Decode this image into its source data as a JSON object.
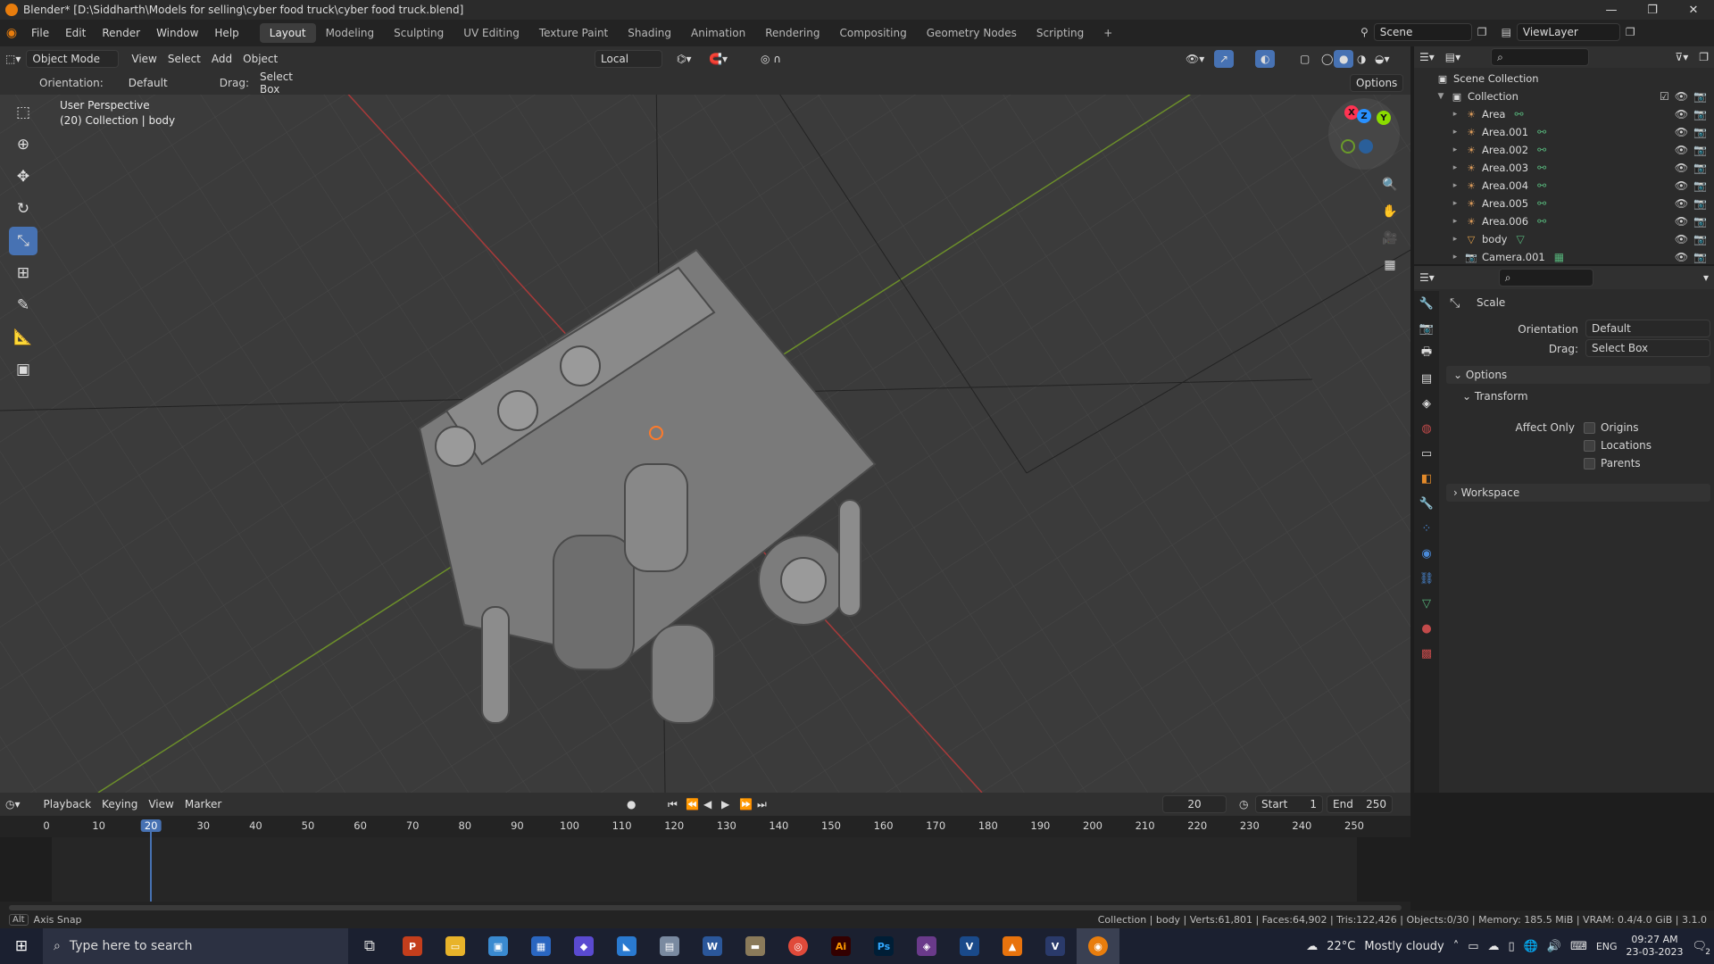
{
  "titlebar": {
    "title": "Blender* [D:\\Siddharth\\Models for selling\\cyber food truck\\cyber food truck.blend]",
    "controls": [
      "—",
      "❐",
      "✕"
    ]
  },
  "menu": [
    "File",
    "Edit",
    "Render",
    "Window",
    "Help"
  ],
  "workspaces": [
    "Layout",
    "Modeling",
    "Sculpting",
    "UV Editing",
    "Texture Paint",
    "Shading",
    "Animation",
    "Rendering",
    "Compositing",
    "Geometry Nodes",
    "Scripting"
  ],
  "active_workspace": "Layout",
  "add_workspace": "+",
  "scene": {
    "label": "Scene",
    "viewlayer": "ViewLayer"
  },
  "viewport_header": {
    "mode": "Object Mode",
    "menus": [
      "View",
      "Select",
      "Add",
      "Object"
    ],
    "transform_orientation": "Local"
  },
  "tool_settings": {
    "orientation_label": "Orientation:",
    "orientation_value": "Default",
    "drag_label": "Drag:",
    "drag_value": "Select Box",
    "options_label": "Options"
  },
  "viewport": {
    "perspective": "User Perspective",
    "collection_info": "(20) Collection | body"
  },
  "gizmo": {
    "x": "X",
    "y": "Y",
    "z": "Z"
  },
  "outliner": {
    "root": "Scene Collection",
    "collection": "Collection",
    "items": [
      {
        "name": "Area",
        "icon": "light-icon"
      },
      {
        "name": "Area.001",
        "icon": "light-icon"
      },
      {
        "name": "Area.002",
        "icon": "light-icon"
      },
      {
        "name": "Area.003",
        "icon": "light-icon"
      },
      {
        "name": "Area.004",
        "icon": "light-icon"
      },
      {
        "name": "Area.005",
        "icon": "light-icon"
      },
      {
        "name": "Area.006",
        "icon": "light-icon"
      },
      {
        "name": "body",
        "icon": "mesh-icon"
      },
      {
        "name": "Camera.001",
        "icon": "camera-icon"
      }
    ]
  },
  "properties": {
    "tool_name": "Scale",
    "orientation_label": "Orientation",
    "orientation_value": "Default",
    "drag_label": "Drag:",
    "drag_value": "Select Box",
    "options_section": "Options",
    "transform_section": "Transform",
    "affect_only_label": "Affect Only",
    "affect_only": [
      "Origins",
      "Locations",
      "Parents"
    ],
    "workspace_section": "Workspace"
  },
  "timeline": {
    "menus": [
      "Playback",
      "Keying",
      "View",
      "Marker"
    ],
    "current_frame": "20",
    "start_label": "Start",
    "start_value": "1",
    "end_label": "End",
    "end_value": "250",
    "ticks": [
      "0",
      "10",
      "20",
      "30",
      "40",
      "50",
      "60",
      "70",
      "80",
      "90",
      "100",
      "110",
      "120",
      "130",
      "140",
      "150",
      "160",
      "170",
      "180",
      "190",
      "200",
      "210",
      "220",
      "230",
      "240",
      "250"
    ]
  },
  "statusbar": {
    "left_key": "Alt",
    "left_hint": "Axis Snap",
    "right": "Collection | body | Verts:61,801 | Faces:64,902 | Tris:122,426 | Objects:0/30 | Memory: 185.5 MiB | VRAM: 0.4/4.0 GiB | 3.1.0"
  },
  "taskbar": {
    "search_placeholder": "Type here to search",
    "weather_temp": "22°C",
    "weather_desc": "Mostly cloudy",
    "lang": "ENG",
    "time": "09:27 AM",
    "date": "23-03-2023",
    "notification_count": "2"
  },
  "colors": {
    "accent": "#4772b3",
    "x_axis": "#ff3352",
    "y_axis": "#8bdc00",
    "z_axis": "#2890ff",
    "blender_orange": "#e87d0d"
  }
}
